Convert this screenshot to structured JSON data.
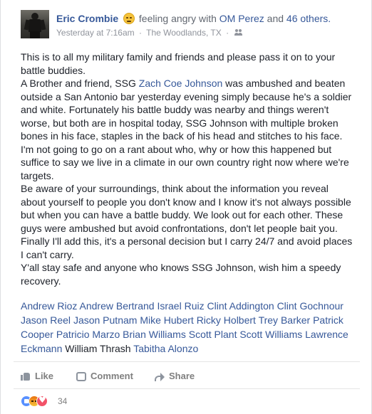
{
  "post": {
    "author": "Eric Crombie",
    "feeling": "feeling angry with",
    "tagged_primary": "OM Perez",
    "and_text": "and",
    "tagged_others": "46 others.",
    "timestamp": "Yesterday at 7:16am",
    "separator": "·",
    "location": "The Woodlands, TX",
    "body": {
      "p1": "This is to all my military family and friends and please pass it on to your battle buddies.",
      "p2a": "A Brother and friend, SSG ",
      "p2_link": "Zach Coe Johnson",
      "p2b": " was ambushed and beaten outside a San Antonio bar yesterday evening simply because he's a soldier and white. Fortunately his battle buddy was nearby and things weren't worse, but both are in hospital today, SSG Johnson with multiple broken bones in his face, staples in the back of his head and stitches to his face.",
      "p3": "I'm not going to go on a rant about who, why or how this happened but suffice to say we live in a climate in our own country right now where we're targets.",
      "p4": "Be aware of your surroundings, think about the information you reveal about yourself to people you don't know and I know it's not always possible but when you can have a battle buddy. We look out for each other. These guys were ambushed but avoid confrontations, don't let people bait you. Finally I'll add this, it's a personal decision but I carry 24/7 and avoid places I can't carry.",
      "p5": "Y'all stay safe and anyone who knows SSG Johnson, wish him a speedy recovery."
    },
    "tags": [
      "Andrew Rioz",
      "Andrew Bertrand",
      "Israel Ruiz",
      "Clint Addington",
      "Clint Gochnour",
      "Jason Reel",
      "Jason Putnam",
      "Mike Hubert",
      "Ricky Holbert",
      "Trey Barker",
      "Patrick Cooper",
      "Patricio Marzo",
      "Brian Williams",
      "Scott Plant",
      "Scott Williams",
      "Lawrence Eckmann",
      "William Thrash",
      "Tabitha Alonzo"
    ],
    "plain_tag": "William Thrash"
  },
  "actions": {
    "like": "Like",
    "comment": "Comment",
    "share": "Share"
  },
  "reactions": {
    "count": "34"
  },
  "colors": {
    "link": "#365899",
    "meta": "#90949c",
    "text": "#1d2129"
  }
}
